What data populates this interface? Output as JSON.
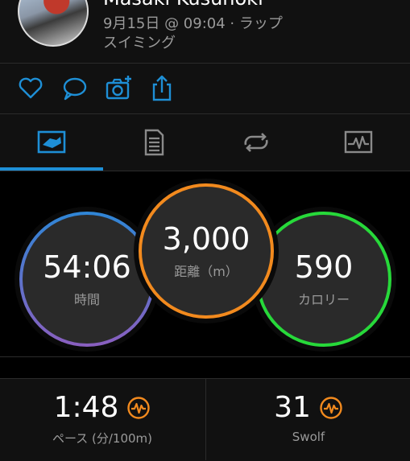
{
  "header": {
    "user_name": "Masaki Kusunoki",
    "date_line": "9月15日 @ 09:04 · ラップ",
    "activity_type": "スイミング"
  },
  "actions": [
    "heart-icon",
    "comment-icon",
    "add-photo-icon",
    "share-icon"
  ],
  "tabs": [
    "overview-tab",
    "details-tab",
    "laps-tab",
    "charts-tab"
  ],
  "stats": {
    "time": {
      "value": "54:06",
      "label": "時間",
      "color": "#2f86d6"
    },
    "distance": {
      "value": "3,000",
      "label": "距離（m）",
      "color": "#f28a1e"
    },
    "calories": {
      "value": "590",
      "label": "カロリー",
      "color": "#27d93a"
    }
  },
  "metrics": {
    "pace": {
      "value": "1:48",
      "label": "ペース (分/100m)"
    },
    "swolf": {
      "value": "31",
      "label": "Swolf"
    }
  },
  "colors": {
    "accent": "#1e8fd6",
    "badge": "#f28a1e"
  }
}
